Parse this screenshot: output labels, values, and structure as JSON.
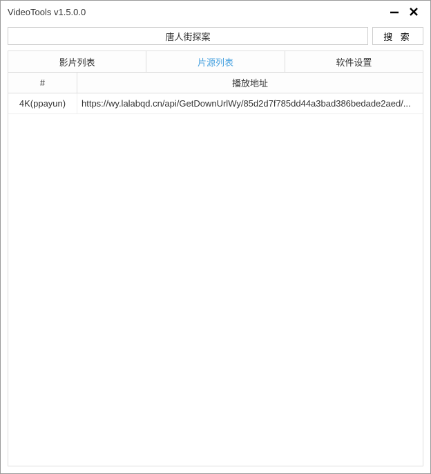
{
  "window": {
    "title": "VideoTools v1.5.0.0"
  },
  "search": {
    "value": "唐人街探案",
    "button": "搜 索"
  },
  "tabs": {
    "movie_list": "影片列表",
    "source_list": "片源列表",
    "settings": "软件设置",
    "active_index": 1
  },
  "table": {
    "headers": {
      "id": "#",
      "url": "播放地址"
    },
    "rows": [
      {
        "id": "4K(ppayun)",
        "url": "https://wy.lalabqd.cn/api/GetDownUrlWy/85d2d7f785dd44a3bad386bedade2aed/..."
      }
    ]
  }
}
